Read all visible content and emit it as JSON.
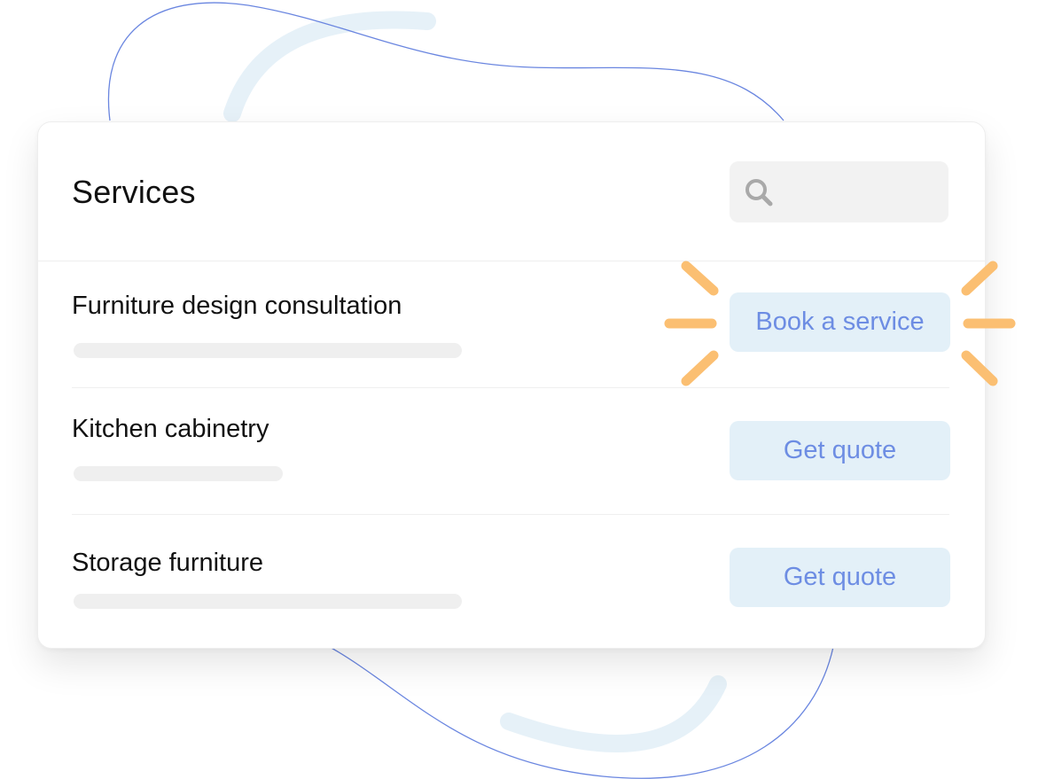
{
  "card": {
    "title": "Services"
  },
  "search": {
    "icon": "search-icon",
    "value": ""
  },
  "services": [
    {
      "name": "Furniture design consultation",
      "action": "Book a service",
      "highlighted": true
    },
    {
      "name": "Kitchen cabinetry",
      "action": "Get quote",
      "highlighted": false
    },
    {
      "name": "Storage furniture",
      "action": "Get quote",
      "highlighted": false
    }
  ],
  "colors": {
    "accent_text": "#6d8de3",
    "button_bg": "#e3f0f8",
    "spark": "#fbbf72",
    "deco_line": "#6a86e0",
    "deco_arc": "#e6f1f8"
  }
}
